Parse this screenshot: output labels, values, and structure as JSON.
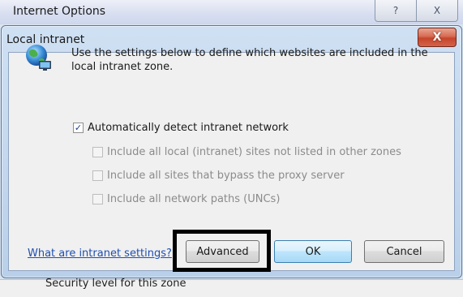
{
  "parent_window": {
    "title": "Internet Options",
    "help_glyph": "?",
    "close_glyph": "X",
    "footer_text": "Security level for this zone"
  },
  "dialog": {
    "title": "Local intranet",
    "close_glyph": "X",
    "intro_text": "Use the settings below to define which websites are included in the local intranet zone.",
    "options": [
      {
        "label": "Automatically detect intranet network",
        "checked": true,
        "enabled": true
      },
      {
        "label": "Include all local (intranet) sites not listed in other zones",
        "checked": false,
        "enabled": false
      },
      {
        "label": "Include all sites that bypass the proxy server",
        "checked": false,
        "enabled": false
      },
      {
        "label": "Include all network paths (UNCs)",
        "checked": false,
        "enabled": false
      }
    ],
    "help_link": "What are intranet settings?",
    "buttons": {
      "advanced": "Advanced",
      "ok": "OK",
      "cancel": "Cancel"
    }
  },
  "icons": {
    "dialog_icon": "globe-network-icon",
    "check_glyph": "✓"
  },
  "colors": {
    "link": "#1f4fb0",
    "close_button": "#c5452c",
    "highlight_border": "#000000",
    "ok_border": "#3c7fb1"
  }
}
